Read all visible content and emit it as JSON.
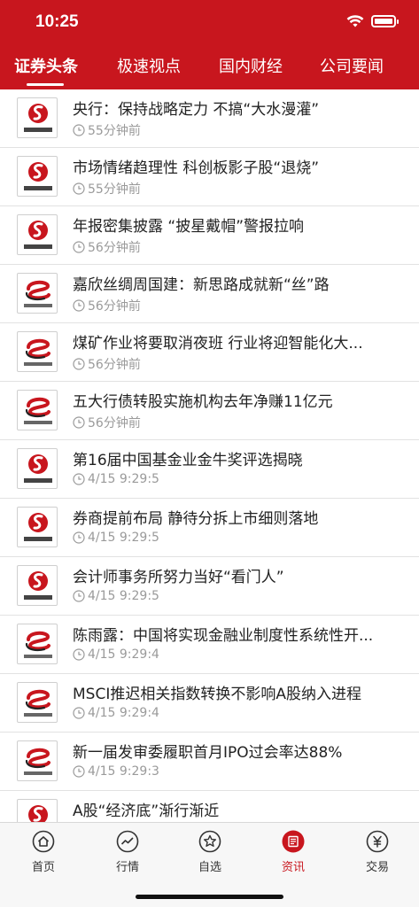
{
  "status_bar": {
    "time": "10:25"
  },
  "tabs": [
    {
      "label": "证券头条",
      "active": true
    },
    {
      "label": "极速视点",
      "active": false
    },
    {
      "label": "国内财经",
      "active": false
    },
    {
      "label": "公司要闻",
      "active": false
    }
  ],
  "news": [
    {
      "title": "央行：保持战略定力 不搞“大水漫灌”",
      "time": "55分钟前",
      "source_logo": "zgzqb-logo"
    },
    {
      "title": "市场情绪趋理性 科创板影子股“退烧”",
      "time": "55分钟前",
      "source_logo": "zgzqb-logo"
    },
    {
      "title": "年报密集披露 “披星戴帽”警报拉响",
      "time": "56分钟前",
      "source_logo": "zgzqb-logo"
    },
    {
      "title": "嘉欣丝绸周国建：新思路成就新“丝”路",
      "time": "56分钟前",
      "source_logo": "shzqb-logo"
    },
    {
      "title": "煤矿作业将要取消夜班 行业将迎智能化大...",
      "time": "56分钟前",
      "source_logo": "shzqb-logo"
    },
    {
      "title": "五大行债转股实施机构去年净赚11亿元",
      "time": "56分钟前",
      "source_logo": "shzqb-logo"
    },
    {
      "title": "第16届中国基金业金牛奖评选揭晓",
      "time": "4/15 9:29:5",
      "source_logo": "zgzqb-logo"
    },
    {
      "title": "券商提前布局 静待分拆上市细则落地",
      "time": "4/15 9:29:5",
      "source_logo": "zgzqb-logo"
    },
    {
      "title": "会计师事务所努力当好“看门人”",
      "time": "4/15 9:29:5",
      "source_logo": "zgzqb-logo"
    },
    {
      "title": "陈雨露：中国将实现金融业制度性系统性开...",
      "time": "4/15 9:29:4",
      "source_logo": "shzqb-logo"
    },
    {
      "title": "MSCI推迟相关指数转换不影响A股纳入进程",
      "time": "4/15 9:29:4",
      "source_logo": "shzqb-logo"
    },
    {
      "title": "新一届发审委履职首月IPO过会率达88%",
      "time": "4/15 9:29:3",
      "source_logo": "shzqb-logo"
    },
    {
      "title": "A股“经济底”渐行渐近",
      "time": "",
      "source_logo": "zgzqb-logo"
    }
  ],
  "bottom_nav": [
    {
      "label": "首页",
      "icon": "home-icon",
      "active": false
    },
    {
      "label": "行情",
      "icon": "chart-icon",
      "active": false
    },
    {
      "label": "自选",
      "icon": "star-icon",
      "active": false
    },
    {
      "label": "资讯",
      "icon": "news-icon",
      "active": true
    },
    {
      "label": "交易",
      "icon": "yuan-icon",
      "active": false
    }
  ],
  "colors": {
    "brand_red": "#c8161e",
    "meta_gray": "#9a9a9a",
    "nav_text": "#333333"
  }
}
